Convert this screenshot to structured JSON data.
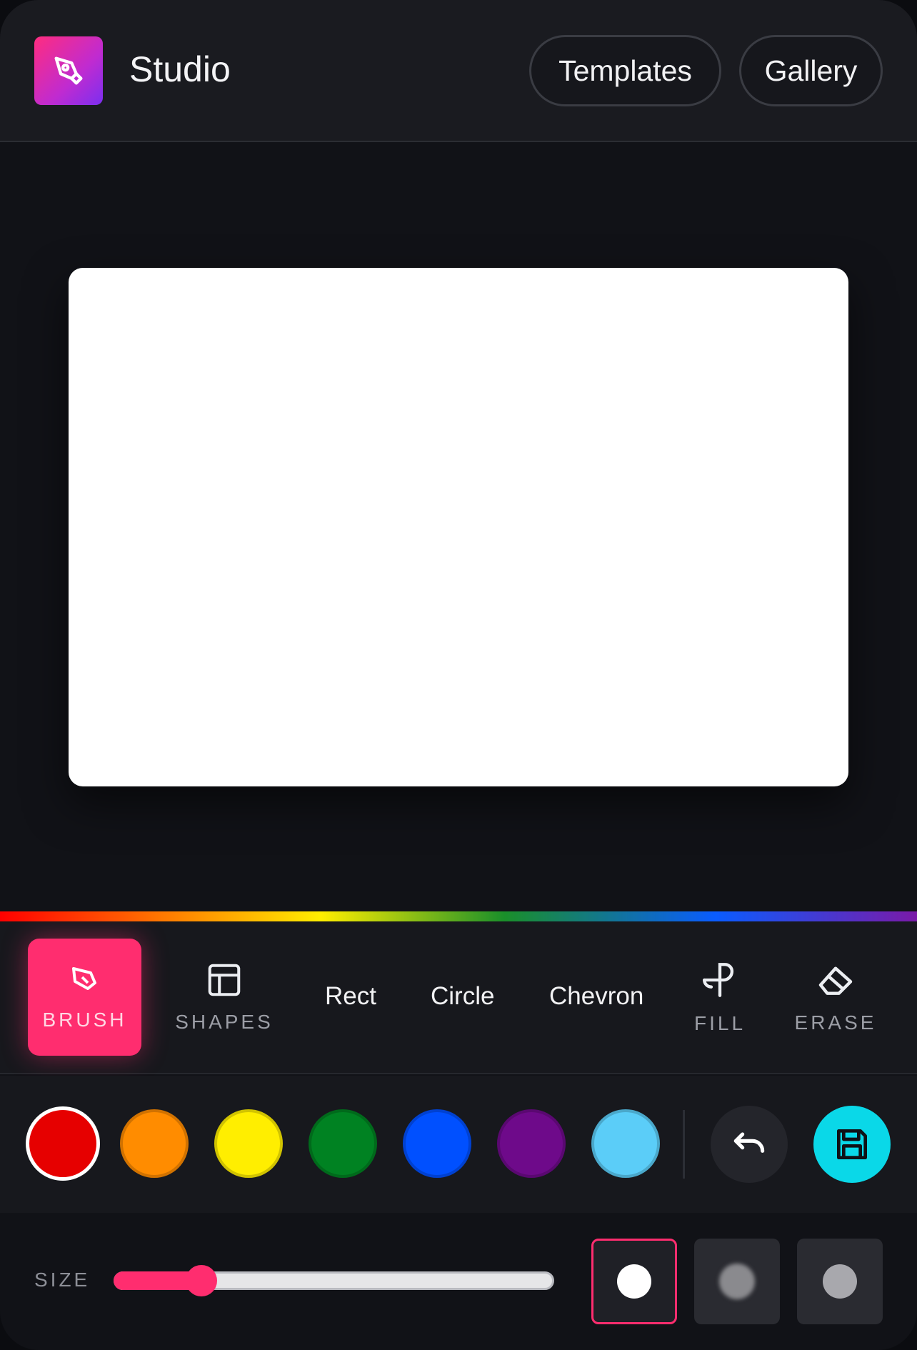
{
  "header": {
    "app_title": "Studio",
    "templates_label": "Templates",
    "gallery_label": "Gallery"
  },
  "tools": {
    "brush_label": "BRUSH",
    "shapes_label": "SHAPES",
    "shape_options": [
      "Rect",
      "Circle",
      "Chevron"
    ],
    "fill_label": "FILL",
    "erase_label": "ERASE"
  },
  "colors": {
    "swatches": [
      "#e60000",
      "#ff8c00",
      "#ffee00",
      "#008222",
      "#0050ff",
      "#6e0a8a",
      "#5bcdf8"
    ],
    "selected": "#e60000",
    "accent": "#ff2d6f",
    "save_color": "#0ad8e8"
  },
  "size": {
    "label": "SIZE",
    "value_fraction": 0.2,
    "brush_types": [
      "hard-round",
      "soft-round",
      "medium-round"
    ],
    "active_brush": "hard-round"
  },
  "icons": {
    "logo": "pen-tool-icon",
    "undo": "undo-icon",
    "save": "save-icon"
  }
}
